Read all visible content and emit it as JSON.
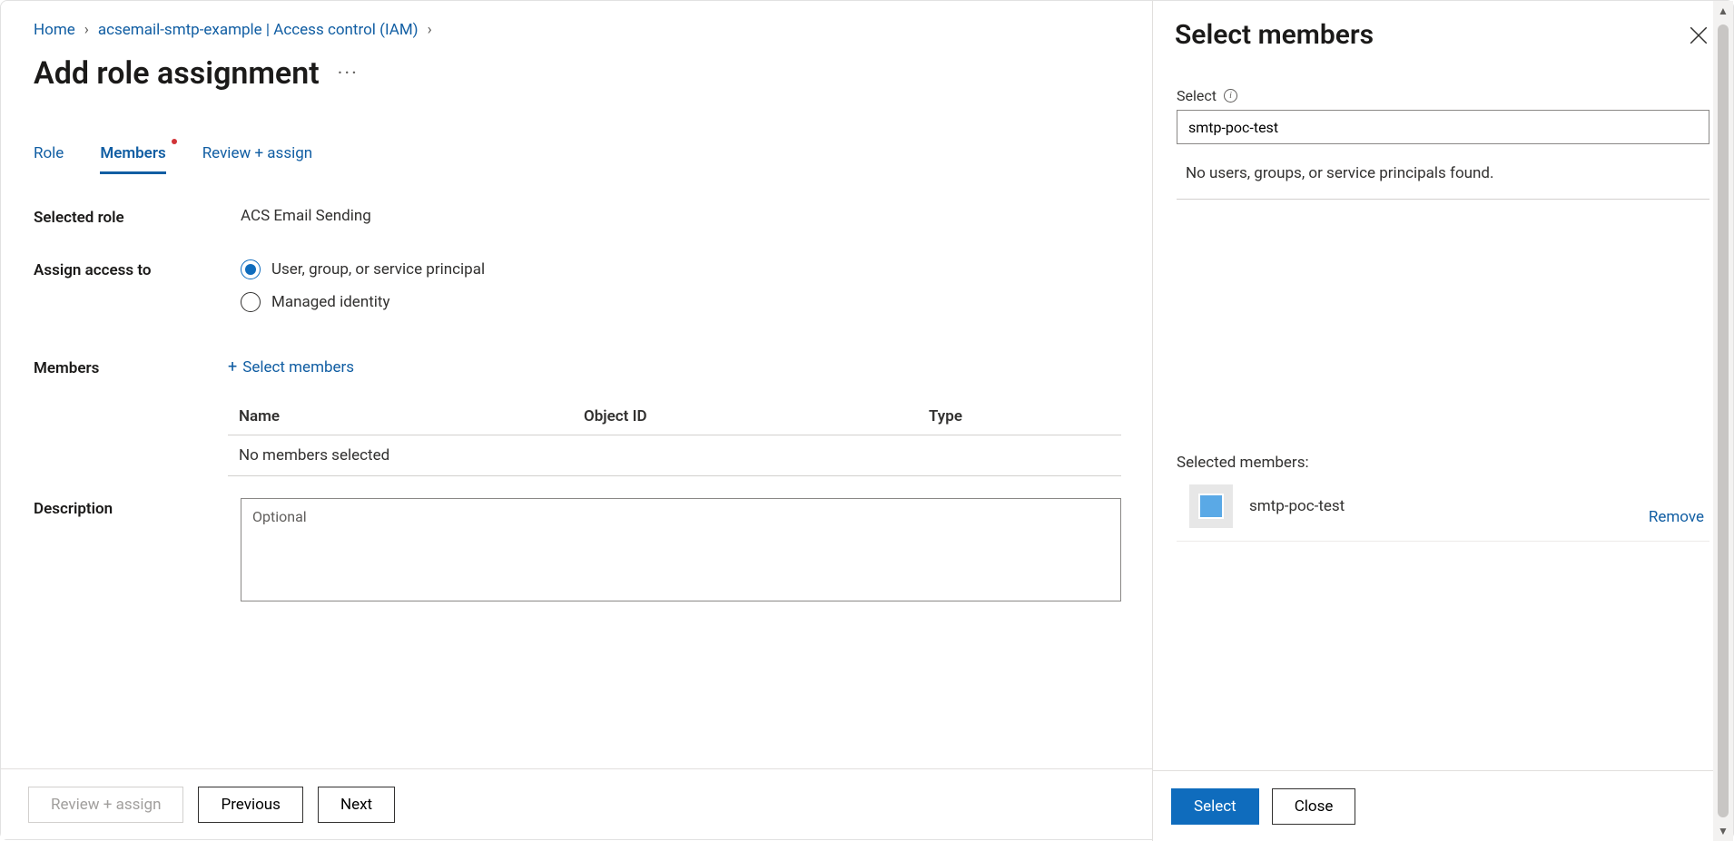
{
  "breadcrumb": {
    "home": "Home",
    "resource": "acsemail-smtp-example | Access control (IAM)"
  },
  "pageTitle": "Add role assignment",
  "tabs": {
    "role": "Role",
    "members": "Members",
    "review": "Review + assign"
  },
  "labels": {
    "selectedRole": "Selected role",
    "assignAccess": "Assign access to",
    "members": "Members",
    "description": "Description"
  },
  "values": {
    "selectedRole": "ACS Email Sending",
    "radio1": "User, group, or service principal",
    "radio2": "Managed identity",
    "selectMembersLink": "Select members",
    "noMembers": "No members selected",
    "descPlaceholder": "Optional"
  },
  "table": {
    "colName": "Name",
    "colOid": "Object ID",
    "colType": "Type"
  },
  "footer": {
    "reviewAssign": "Review + assign",
    "previous": "Previous",
    "next": "Next"
  },
  "panel": {
    "title": "Select members",
    "selectLabel": "Select",
    "searchValue": "smtp-poc-test",
    "noResults": "No users, groups, or service principals found.",
    "selectedLabel": "Selected members:",
    "memberName": "smtp-poc-test",
    "remove": "Remove",
    "selectBtn": "Select",
    "closeBtn": "Close"
  }
}
